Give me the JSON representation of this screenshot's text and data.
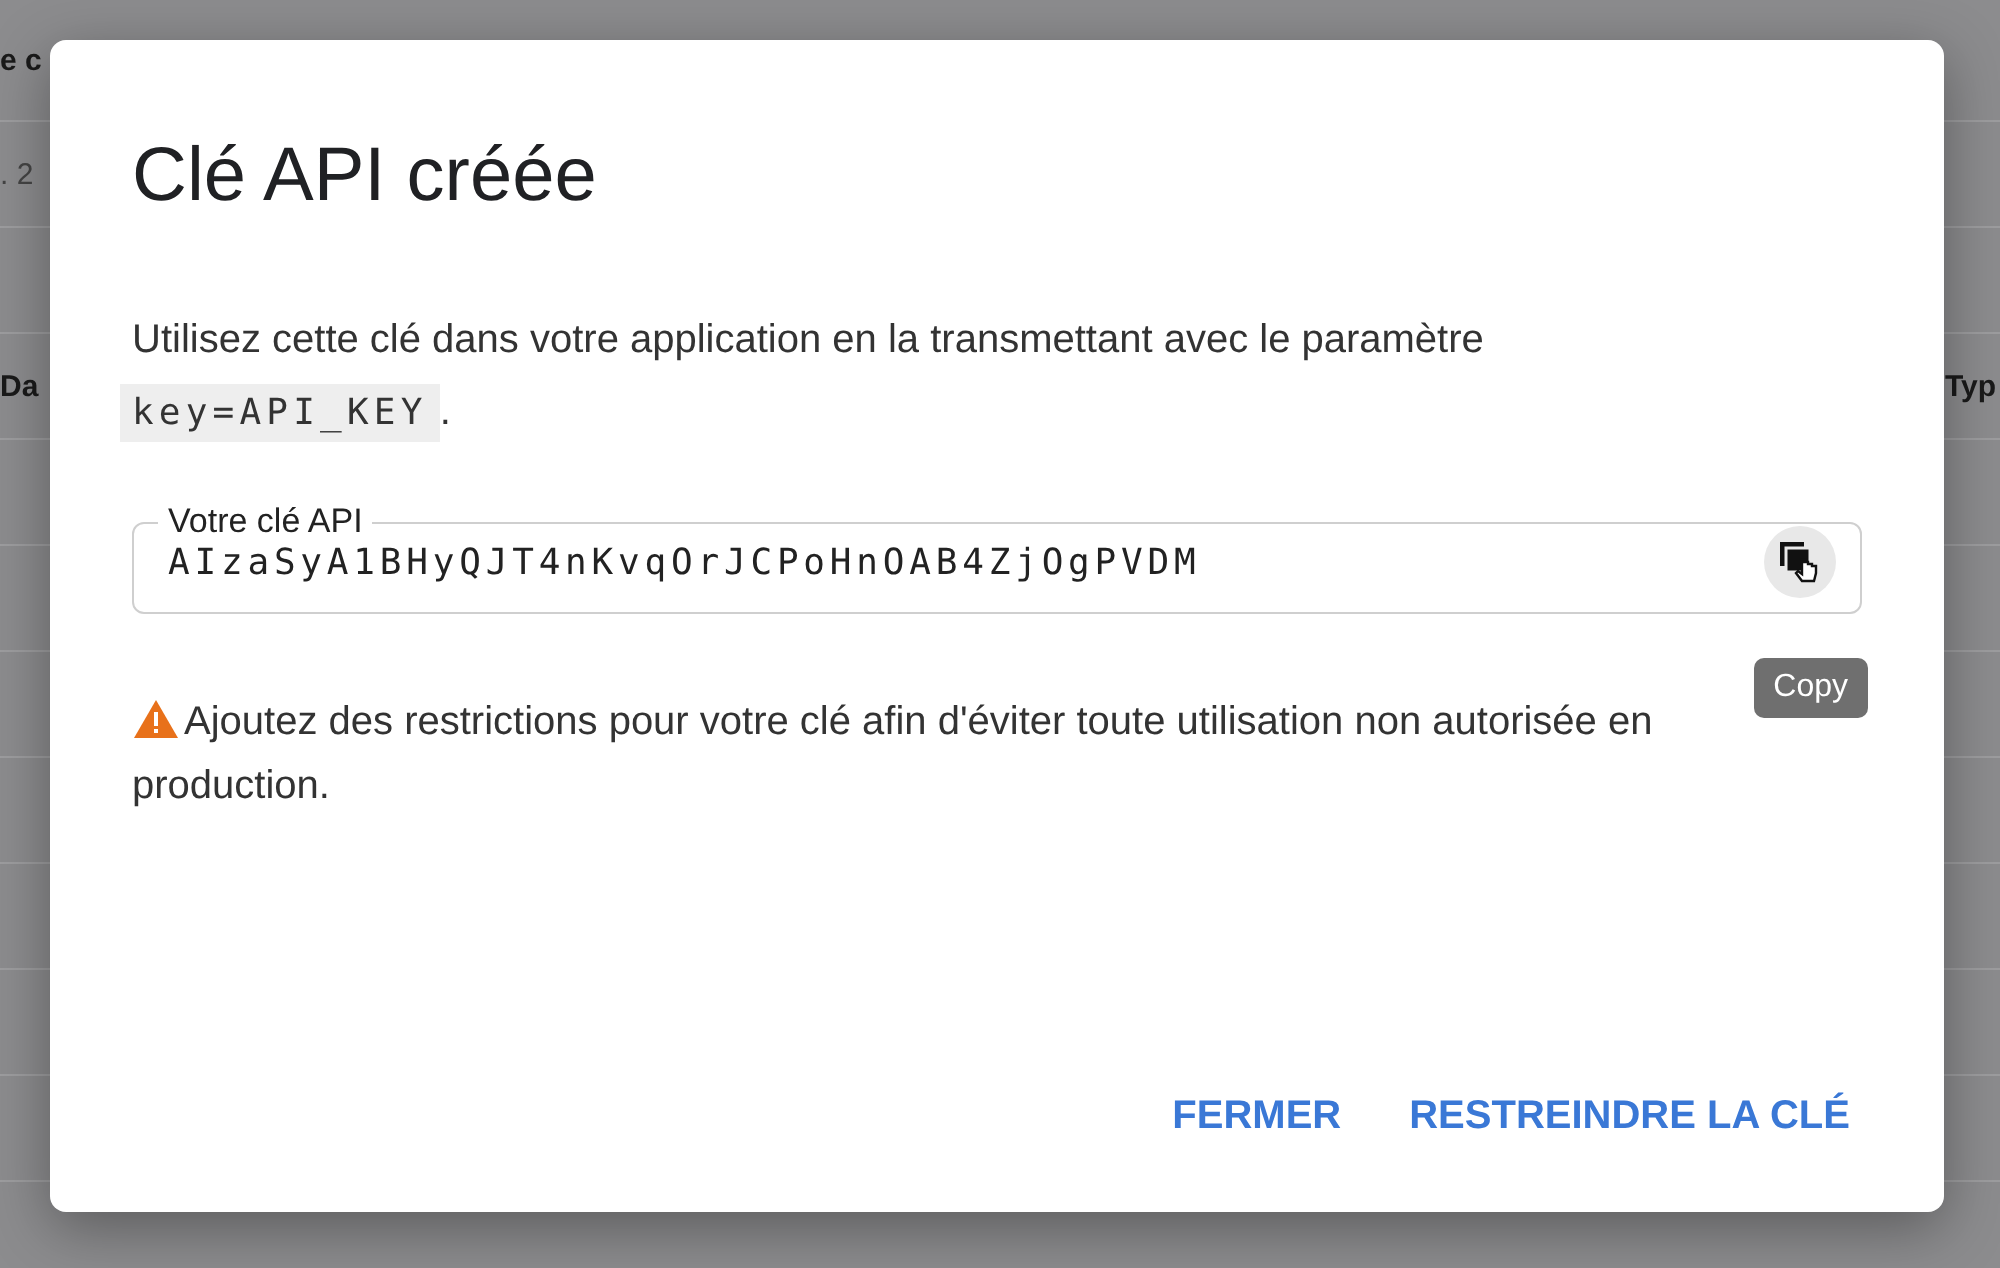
{
  "background": {
    "texts": [
      {
        "text": "e c",
        "kind": "header"
      },
      {
        "text": ". 2",
        "kind": "cell"
      },
      {
        "text": "Da",
        "kind": "header"
      },
      {
        "text": "Typ",
        "kind": "header-right"
      }
    ]
  },
  "dialog": {
    "title": "Clé API créée",
    "description": "Utilisez cette clé dans votre application en la transmettant avec le paramètre",
    "parameter": "key=API_KEY",
    "parameter_suffix": ".",
    "key_field": {
      "label": "Votre clé API",
      "value": "AIzaSyA1BHyQJT4nKvqOrJCPoHnOAB4ZjOgPVDM"
    },
    "tooltip": "Copy",
    "warning": "Ajoutez des restrictions pour votre clé afin d'éviter toute utilisation non autorisée en production.",
    "buttons": [
      "FERMER",
      "RESTREINDRE LA CLÉ"
    ]
  }
}
